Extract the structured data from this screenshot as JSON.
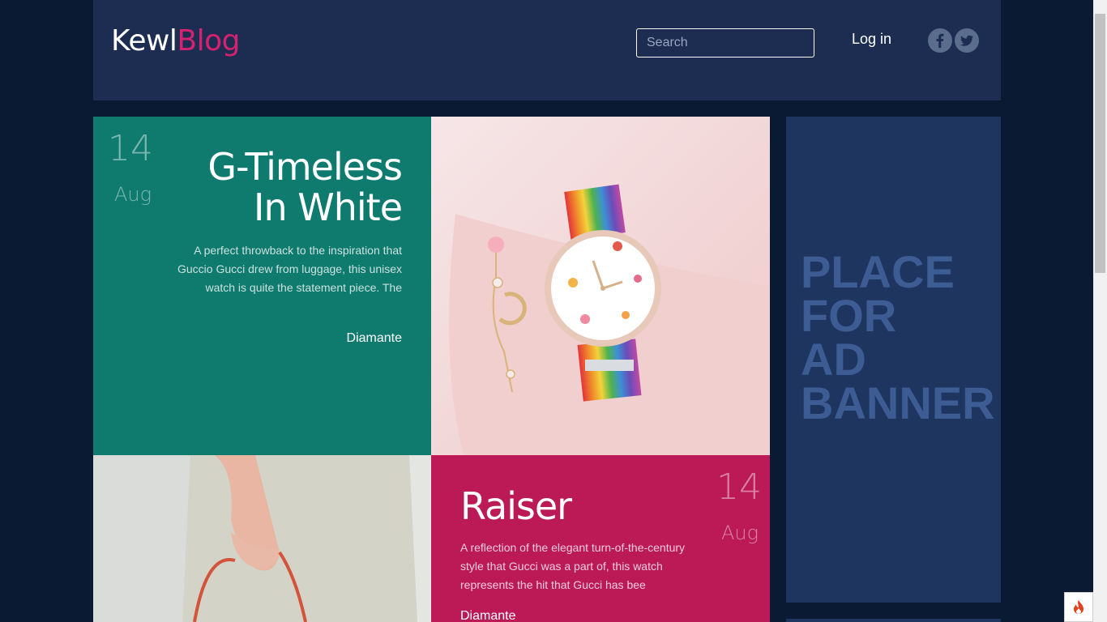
{
  "header": {
    "logo_part1": "Kewl",
    "logo_part2": "Blog",
    "search_placeholder": "Search",
    "login_label": "Log in",
    "social": [
      "facebook-icon",
      "twitter-icon"
    ]
  },
  "posts": [
    {
      "day": "14",
      "month": "Aug",
      "title_line1": "G-Timeless",
      "title_line2": "In White",
      "excerpt": "A perfect throwback to the inspiration that Guccio Gucci drew from luggage, this unisex watch is quite the statement piece. The",
      "author": "Diamante",
      "bg_color": "#0f7a6e"
    },
    {
      "day": "14",
      "month": "Aug",
      "title": "Raiser",
      "excerpt": "A reflection of the elegant turn-of-the-century style that Gucci was a part of, this watch represents the hit that Gucci has bee",
      "author": "Diamante",
      "bg_color": "#bb1a57"
    }
  ],
  "ad": {
    "line1": "PLACE",
    "line2": "FOR",
    "line3": "AD",
    "line4": "BANNER"
  },
  "colors": {
    "page_bg": "#0b1a33",
    "header_bg": "#1d2d52",
    "accent_pink": "#d4226f",
    "ad_bg": "#1e3560",
    "ad_text": "#3d5c94"
  }
}
